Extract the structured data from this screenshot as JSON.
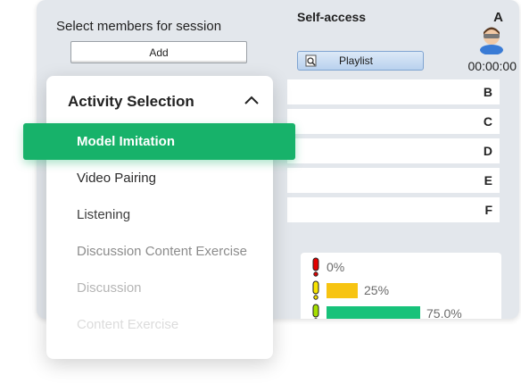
{
  "left_panel": {
    "select_label": "Select members for session",
    "add_label": "Add"
  },
  "right_panel": {
    "title": "Self-access",
    "first_letter": "A",
    "playlist_label": "Playlist",
    "timer": "00:00:00",
    "rows": [
      "B",
      "C",
      "D",
      "E",
      "F"
    ]
  },
  "progress": [
    {
      "label": "0%",
      "value": 0,
      "color": "#e30000"
    },
    {
      "label": "25%",
      "value": 0.25,
      "color": "#f7c412"
    },
    {
      "label": "75.0%",
      "value": 0.75,
      "color": "#17c27a"
    }
  ],
  "dropdown": {
    "title": "Activity Selection",
    "selected": "Model Imitation",
    "items": [
      {
        "label": "Video Pairing",
        "color": "#2b2b2b"
      },
      {
        "label": "Listening",
        "color": "#3d3d3d"
      },
      {
        "label": "Discussion Content Exercise",
        "color": "#8c8c8c"
      },
      {
        "label": "Discussion",
        "color": "#b5b5b5"
      },
      {
        "label": "Content Exercise",
        "color": "#dcdcdc"
      }
    ]
  },
  "colors": {
    "accent": "#17b26a",
    "panel_bg": "#e3e7ec"
  },
  "icons": [
    "avatar-icon",
    "magnifier-icon",
    "chevron-up-icon",
    "exclamation-icon"
  ]
}
